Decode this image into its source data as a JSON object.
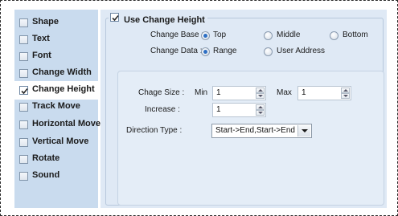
{
  "categories": [
    {
      "label": "Shape",
      "checked": false,
      "selected": false
    },
    {
      "label": "Text",
      "checked": false,
      "selected": false
    },
    {
      "label": "Font",
      "checked": false,
      "selected": false
    },
    {
      "label": "Change Width",
      "checked": false,
      "selected": false
    },
    {
      "label": "Change Height",
      "checked": true,
      "selected": true
    },
    {
      "label": "Track Move",
      "checked": false,
      "selected": false
    },
    {
      "label": "Horizontal Move",
      "checked": false,
      "selected": false
    },
    {
      "label": "Vertical Move",
      "checked": false,
      "selected": false
    },
    {
      "label": "Rotate",
      "checked": false,
      "selected": false
    },
    {
      "label": "Sound",
      "checked": false,
      "selected": false
    }
  ],
  "group": {
    "title": "Use Change Height",
    "checked": true
  },
  "change_base": {
    "label": "Change Base :",
    "options": [
      "Top",
      "Middle",
      "Bottom"
    ],
    "selected": "Top"
  },
  "change_data": {
    "label": "Change Data :",
    "options": [
      "Range",
      "User Address"
    ],
    "selected": "Range"
  },
  "range": {
    "change_size_label": "Chage Size :",
    "min_label": "Min",
    "min_value": "1",
    "max_label": "Max",
    "max_value": "1",
    "increase_label": "Increase :",
    "increase_value": "1",
    "direction_label": "Direction Type :",
    "direction_value": "Start->End,Start->End"
  },
  "colors": {
    "sidebar_bg": "#c9dbee",
    "panel_bg": "#dfe9f5",
    "radio_dot": "#2d6fc4"
  }
}
